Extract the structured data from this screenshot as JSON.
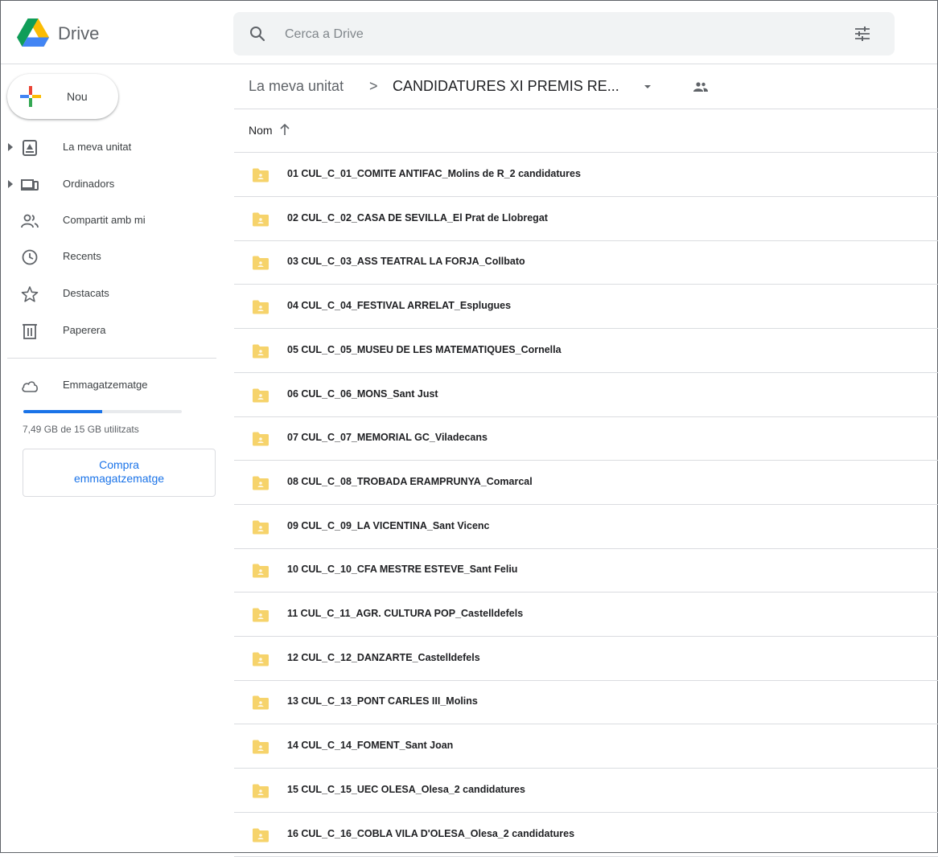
{
  "app": {
    "name": "Drive"
  },
  "search": {
    "placeholder": "Cerca a Drive"
  },
  "sidebar": {
    "new_label": "Nou",
    "items": [
      {
        "label": "La meva unitat",
        "icon": "my-drive-icon",
        "expandable": true
      },
      {
        "label": "Ordinadors",
        "icon": "computers-icon",
        "expandable": true
      },
      {
        "label": "Compartit amb mi",
        "icon": "shared-icon",
        "expandable": false
      },
      {
        "label": "Recents",
        "icon": "clock-icon",
        "expandable": false
      },
      {
        "label": "Destacats",
        "icon": "star-icon",
        "expandable": false
      },
      {
        "label": "Paperera",
        "icon": "trash-icon",
        "expandable": false
      }
    ],
    "storage": {
      "label": "Emmagatzematge",
      "used_text": "7,49 GB de 15 GB utilitzats",
      "used_fraction": 0.499
    },
    "buy_button": {
      "line1": "Compra",
      "line2": "emmagatzematge"
    }
  },
  "breadcrumb": {
    "root": "La meva unitat",
    "separator": ">",
    "current": "CANDIDATURES XI PREMIS RE..."
  },
  "list": {
    "sort_column": "Nom",
    "sort_direction": "ascending",
    "files": [
      "01 CUL_C_01_COMITE ANTIFAC_Molins de R_2 candidatures",
      "02 CUL_C_02_CASA DE SEVILLA_El Prat de Llobregat",
      "03 CUL_C_03_ASS TEATRAL LA FORJA_Collbato",
      "04 CUL_C_04_FESTIVAL ARRELAT_Esplugues",
      "05 CUL_C_05_MUSEU DE LES MATEMATIQUES_Cornella",
      "06 CUL_C_06_MONS_Sant Just",
      "07 CUL_C_07_MEMORIAL GC_Viladecans",
      "08 CUL_C_08_TROBADA ERAMPRUNYA_Comarcal",
      "09 CUL_C_09_LA VICENTINA_Sant Vicenc",
      "10 CUL_C_10_CFA MESTRE ESTEVE_Sant Feliu",
      "11 CUL_C_11_AGR. CULTURA POP_Castelldefels",
      "12 CUL_C_12_DANZARTE_Castelldefels",
      "13 CUL_C_13_PONT CARLES III_Molins",
      "14 CUL_C_14_FOMENT_Sant Joan",
      "15 CUL_C_15_UEC OLESA_Olesa_2 candidatures",
      "16 CUL_C_16_COBLA VILA D'OLESA_Olesa_2 candidatures"
    ]
  },
  "colors": {
    "accent": "#1a73e8",
    "folder": "#f6d36b",
    "divider": "#dadce0",
    "search_bg": "#f1f3f4"
  }
}
